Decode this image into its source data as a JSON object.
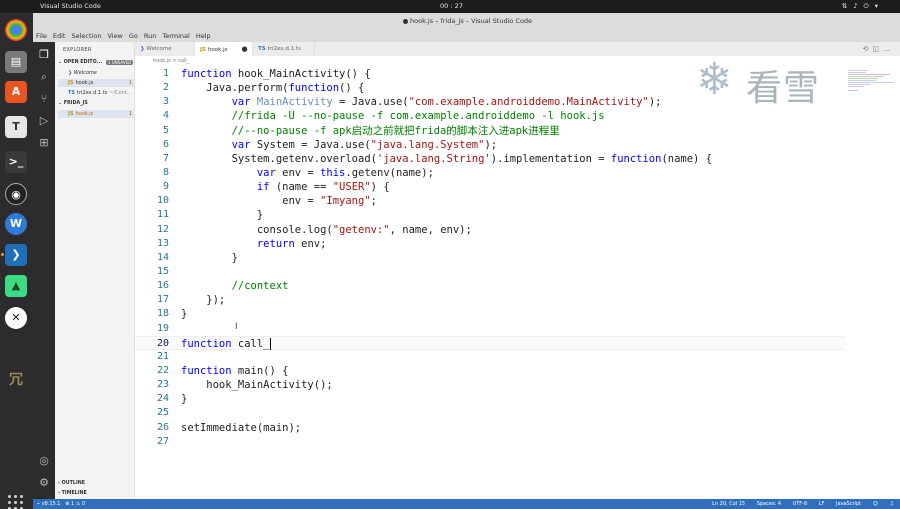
{
  "system": {
    "app_name": "Visual Studio Code",
    "clock": "00 : 27"
  },
  "window": {
    "title": "hook.js – frida_js – Visual Studio Code"
  },
  "menu": [
    "File",
    "Edit",
    "Selection",
    "View",
    "Go",
    "Run",
    "Terminal",
    "Help"
  ],
  "sidebar": {
    "title": "EXPLORER",
    "open_editors_label": "OPEN EDITO...",
    "open_editors_badge": "1 UNSAVED",
    "open_editors": [
      {
        "name": "Welcome",
        "icon": "vscode-icon"
      },
      {
        "name": "hook.js",
        "icon": "js-icon",
        "badge": "1"
      },
      {
        "name": "tri2ex.d.1.ts",
        "sub": "~/Cont...",
        "icon": "ts-icon"
      }
    ],
    "project_label": "FRIDA_JS",
    "project_files": [
      {
        "name": "hook.js",
        "icon": "js-icon",
        "badge": "1"
      }
    ],
    "outline_label": "OUTLINE",
    "timeline_label": "TIMELINE"
  },
  "tabs": [
    {
      "label": "Welcome",
      "active": false
    },
    {
      "label": "hook.js",
      "active": true,
      "modified": true
    },
    {
      "label": "tri2ex.d.1.ts",
      "active": false
    }
  ],
  "breadcrumb": "hook.js > call_",
  "editor": {
    "current_line": 20,
    "lines": [
      "function hook_MainActivity() {",
      "    Java.perform(function() {",
      "        var MainActivity = Java.use(\"com.example.androiddemo.MainActivity\");",
      "        //frida -U --no-pause -f com.example.androiddemo -l hook.js",
      "        //--no-pause -f apk启动之前就把frida的脚本注入进apk进程里",
      "        var System = Java.use(\"java.lang.System\");",
      "        System.getenv.overload('java.lang.String').implementation = function(name) {",
      "            var env = this.getenv(name);",
      "            if (name == \"USER\") {",
      "                env = \"Imyang\";",
      "            }",
      "            console.log(\"getenv:\", name, env);",
      "            return env;",
      "        }",
      "",
      "        //context",
      "    });",
      "}",
      "",
      "function call_",
      "",
      "function main() {",
      "    hook_MainActivity();",
      "}",
      "",
      "setImmediate(main);",
      ""
    ]
  },
  "watermark": {
    "text": "看雪",
    "icon": "snowflake-icon"
  },
  "statusbar": {
    "branch": "v8.15.1",
    "problems": "⊗ 1 ⚠ 0",
    "position": "Ln 20, Col 15",
    "spaces": "Spaces: 4",
    "encoding": "UTF-8",
    "eol": "LF",
    "language": "JavaScript"
  },
  "colors": {
    "keyword": "#0000ff",
    "string": "#a31515",
    "comment": "#008000",
    "statusbar": "#2f6fbd",
    "line_numbers": "#237893"
  }
}
